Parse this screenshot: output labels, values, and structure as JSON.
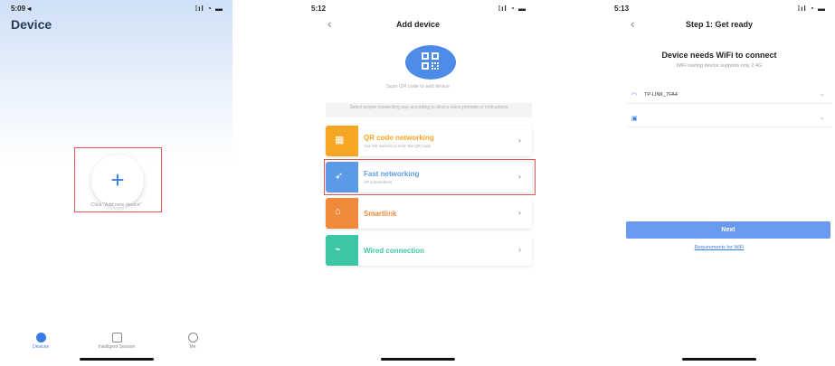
{
  "screen1": {
    "time": "5:09 ◂",
    "signal": "⁞ıl ◔ ▬",
    "title": "Device",
    "plus": "+",
    "hint": "Click \"Add new device\"",
    "tabs": [
      {
        "label": "Devices",
        "icon": "devices-icon",
        "active": true
      },
      {
        "label": "Intelligent Session",
        "icon": "session-icon",
        "active": false
      },
      {
        "label": "Me",
        "icon": "me-icon",
        "active": false
      }
    ]
  },
  "screen2": {
    "time": "5:12",
    "signal": "⁞ıl ◔ ▬",
    "title": "Add device",
    "back": "‹",
    "qr_caption": "Scan QR code to add device",
    "instruction": "Select proper connecting way according to device voice prompts or instructions",
    "options": [
      {
        "label": "QR code networking",
        "sub": "Use the camera to scan the QR code",
        "color": "#f5a623",
        "icon": "qr-icon",
        "glyph": "▦"
      },
      {
        "label": "Fast networking",
        "sub": "AP connections",
        "color": "#5b9be6",
        "icon": "rocket-icon",
        "glyph": "➶"
      },
      {
        "label": "Smartlink",
        "sub": "",
        "color": "#f0893a",
        "icon": "smartlink-icon",
        "glyph": "⌂"
      },
      {
        "label": "Wired connection",
        "sub": "",
        "color": "#3cc6a5",
        "icon": "plug-icon",
        "glyph": "⌁"
      }
    ],
    "label_colors": [
      "#f5a623",
      "#5b9be6",
      "#f0893a",
      "#3cc6a5"
    ],
    "chevron": "›"
  },
  "screen3": {
    "time": "5:13",
    "signal": "⁞ıl ◔ ▬",
    "title": "Step 1: Get ready",
    "back": "‹",
    "heading": "Device needs WiFi to connect",
    "subheading": "WiFi routing device supports only 2.4G",
    "wifi_value": "TP-LINK_7FA4",
    "password_value": "",
    "next_label": "Next",
    "requirements_link": "Requirements for WiFi"
  }
}
